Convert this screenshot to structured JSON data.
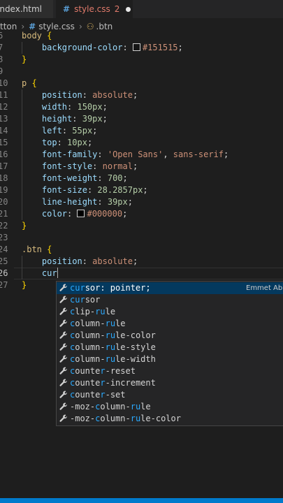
{
  "tabs": [
    {
      "label": "index.html",
      "active": false
    },
    {
      "label": "style.css",
      "problems": "2",
      "active": true,
      "modified": true
    }
  ],
  "breadcrumb": {
    "folder": "tton",
    "file": "style.css",
    "symbol": ".btn"
  },
  "code_lines": [
    {
      "n": "6",
      "parts": [
        {
          "c": "sel",
          "t": "body "
        },
        {
          "c": "brace",
          "t": "{"
        }
      ]
    },
    {
      "n": "7",
      "parts": [
        {
          "c": "plain",
          "t": "    "
        },
        {
          "c": "prop",
          "t": "background-color"
        },
        {
          "c": "plain",
          "t": ": "
        },
        {
          "c": "swatch",
          "t": "#151515"
        },
        {
          "c": "val",
          "t": "#151515"
        },
        {
          "c": "plain",
          "t": ";"
        }
      ]
    },
    {
      "n": "8",
      "parts": [
        {
          "c": "brace",
          "t": "}"
        }
      ]
    },
    {
      "n": "9",
      "parts": []
    },
    {
      "n": "10",
      "parts": [
        {
          "c": "sel",
          "t": "p "
        },
        {
          "c": "brace",
          "t": "{"
        }
      ]
    },
    {
      "n": "11",
      "parts": [
        {
          "c": "plain",
          "t": "    "
        },
        {
          "c": "prop",
          "t": "position"
        },
        {
          "c": "plain",
          "t": ": "
        },
        {
          "c": "val",
          "t": "absolute"
        },
        {
          "c": "plain",
          "t": ";"
        }
      ]
    },
    {
      "n": "12",
      "parts": [
        {
          "c": "plain",
          "t": "    "
        },
        {
          "c": "prop",
          "t": "width"
        },
        {
          "c": "plain",
          "t": ": "
        },
        {
          "c": "num",
          "t": "150px"
        },
        {
          "c": "plain",
          "t": ";"
        }
      ]
    },
    {
      "n": "13",
      "parts": [
        {
          "c": "plain",
          "t": "    "
        },
        {
          "c": "prop",
          "t": "height"
        },
        {
          "c": "plain",
          "t": ": "
        },
        {
          "c": "num",
          "t": "39px"
        },
        {
          "c": "plain",
          "t": ";"
        }
      ]
    },
    {
      "n": "14",
      "parts": [
        {
          "c": "plain",
          "t": "    "
        },
        {
          "c": "prop",
          "t": "left"
        },
        {
          "c": "plain",
          "t": ": "
        },
        {
          "c": "num",
          "t": "55px"
        },
        {
          "c": "plain",
          "t": ";"
        }
      ]
    },
    {
      "n": "15",
      "parts": [
        {
          "c": "plain",
          "t": "    "
        },
        {
          "c": "prop",
          "t": "top"
        },
        {
          "c": "plain",
          "t": ": "
        },
        {
          "c": "num",
          "t": "10px"
        },
        {
          "c": "plain",
          "t": ";"
        }
      ]
    },
    {
      "n": "16",
      "parts": [
        {
          "c": "plain",
          "t": "    "
        },
        {
          "c": "prop",
          "t": "font-family"
        },
        {
          "c": "plain",
          "t": ": "
        },
        {
          "c": "val",
          "t": "'Open Sans'"
        },
        {
          "c": "plain",
          "t": ", "
        },
        {
          "c": "val",
          "t": "sans-serif"
        },
        {
          "c": "plain",
          "t": ";"
        }
      ]
    },
    {
      "n": "17",
      "parts": [
        {
          "c": "plain",
          "t": "    "
        },
        {
          "c": "prop",
          "t": "font-style"
        },
        {
          "c": "plain",
          "t": ": "
        },
        {
          "c": "val",
          "t": "normal"
        },
        {
          "c": "plain",
          "t": ";"
        }
      ]
    },
    {
      "n": "18",
      "parts": [
        {
          "c": "plain",
          "t": "    "
        },
        {
          "c": "prop",
          "t": "font-weight"
        },
        {
          "c": "plain",
          "t": ": "
        },
        {
          "c": "num",
          "t": "700"
        },
        {
          "c": "plain",
          "t": ";"
        }
      ]
    },
    {
      "n": "19",
      "parts": [
        {
          "c": "plain",
          "t": "    "
        },
        {
          "c": "prop",
          "t": "font-size"
        },
        {
          "c": "plain",
          "t": ": "
        },
        {
          "c": "num",
          "t": "28.2857px"
        },
        {
          "c": "plain",
          "t": ";"
        }
      ]
    },
    {
      "n": "20",
      "parts": [
        {
          "c": "plain",
          "t": "    "
        },
        {
          "c": "prop",
          "t": "line-height"
        },
        {
          "c": "plain",
          "t": ": "
        },
        {
          "c": "num",
          "t": "39px"
        },
        {
          "c": "plain",
          "t": ";"
        }
      ]
    },
    {
      "n": "21",
      "parts": [
        {
          "c": "plain",
          "t": "    "
        },
        {
          "c": "prop",
          "t": "color"
        },
        {
          "c": "plain",
          "t": ": "
        },
        {
          "c": "swatch",
          "t": "#000000"
        },
        {
          "c": "val",
          "t": "#000000"
        },
        {
          "c": "plain",
          "t": ";"
        }
      ]
    },
    {
      "n": "22",
      "parts": [
        {
          "c": "brace",
          "t": "}"
        }
      ]
    },
    {
      "n": "23",
      "parts": []
    },
    {
      "n": "24",
      "parts": [
        {
          "c": "sel",
          "t": ".btn "
        },
        {
          "c": "brace",
          "t": "{"
        }
      ]
    },
    {
      "n": "25",
      "parts": [
        {
          "c": "plain",
          "t": "    "
        },
        {
          "c": "prop",
          "t": "position"
        },
        {
          "c": "plain",
          "t": ": "
        },
        {
          "c": "val",
          "t": "absolute"
        },
        {
          "c": "plain",
          "t": ";"
        }
      ]
    },
    {
      "n": "26",
      "current": true,
      "parts": [
        {
          "c": "plain",
          "t": "    "
        },
        {
          "c": "prop",
          "t": "cur"
        },
        {
          "c": "cursor",
          "t": ""
        }
      ]
    },
    {
      "n": "27",
      "parts": [
        {
          "c": "brace",
          "t": "}"
        }
      ]
    }
  ],
  "suggestions": {
    "typed": "cur",
    "detail": "Emmet Abb",
    "items": [
      {
        "pre": "",
        "match": "cur",
        "post": "sor: pointer;",
        "focused": true
      },
      {
        "pre": "",
        "match": "cur",
        "post": "sor"
      },
      {
        "pre": "",
        "match": "c",
        "post": "lip-",
        "match2": "ru",
        "post2": "le"
      },
      {
        "pre": "",
        "match": "c",
        "post": "olumn-",
        "match2": "ru",
        "post2": "le"
      },
      {
        "pre": "",
        "match": "c",
        "post": "olumn-",
        "match2": "ru",
        "post2": "le-color"
      },
      {
        "pre": "",
        "match": "c",
        "post": "olumn-",
        "match2": "ru",
        "post2": "le-style"
      },
      {
        "pre": "",
        "match": "c",
        "post": "olumn-",
        "match2": "ru",
        "post2": "le-width"
      },
      {
        "pre": "",
        "match": "c",
        "post": "ounte",
        "match2": "r",
        "post2": "-reset"
      },
      {
        "pre": "",
        "match": "c",
        "post": "ounte",
        "match2": "r",
        "post2": "-increment"
      },
      {
        "pre": "",
        "match": "c",
        "post": "ounte",
        "match2": "r",
        "post2": "-set"
      },
      {
        "pre": "-moz-",
        "match": "c",
        "post": "olumn-",
        "match2": "ru",
        "post2": "le"
      },
      {
        "pre": "-moz-",
        "match": "c",
        "post": "olumn-",
        "match2": "ru",
        "post2": "le-color"
      }
    ]
  },
  "colors": {
    "editor_bg": "#1e1e1e",
    "accent": "#007acc",
    "focused_row": "#04395e",
    "match": "#2aaaff"
  }
}
